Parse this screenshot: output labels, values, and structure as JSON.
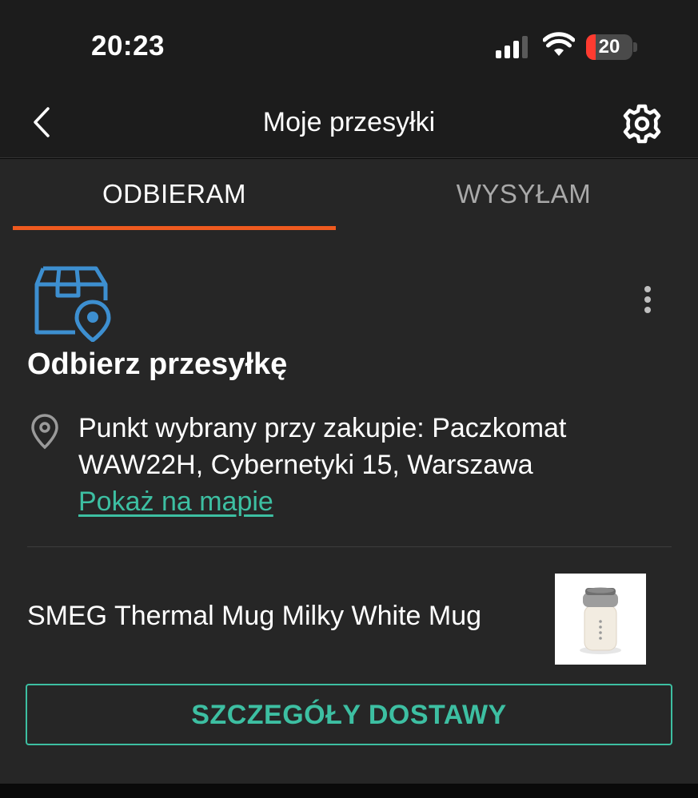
{
  "status_bar": {
    "time": "20:23",
    "battery_level": "20",
    "battery_fraction": 0.2,
    "icons": [
      "cellular-signal-icon",
      "wifi-icon",
      "battery-icon"
    ]
  },
  "nav": {
    "title": "Moje przesyłki",
    "back_icon": "chevron-left-icon",
    "settings_icon": "gear-icon"
  },
  "tabs": [
    {
      "label": "ODBIERAM",
      "active": true
    },
    {
      "label": "WYSYŁAM",
      "active": false
    }
  ],
  "shipment": {
    "status_icon": "package-location-icon",
    "title": "Odbierz przesyłkę",
    "location_icon": "map-pin-icon",
    "address": "Punkt wybrany przy zakupie: Paczkomat WAW22H, Cybernetyki 15, Warszawa",
    "map_link": "Pokaż na mapie",
    "menu_icon": "vertical-dots-icon"
  },
  "product": {
    "name": "SMEG Thermal Mug Milky White Mug",
    "thumbnail_icon": "thermal-mug-image"
  },
  "actions": {
    "details_button": "SZCZEGÓŁY DOSTAWY"
  },
  "colors": {
    "accent_orange": "#ee5a1f",
    "accent_teal": "#3dbfa2",
    "icon_blue": "#3d8fd0",
    "background": "#262626",
    "header": "#1c1c1c"
  }
}
